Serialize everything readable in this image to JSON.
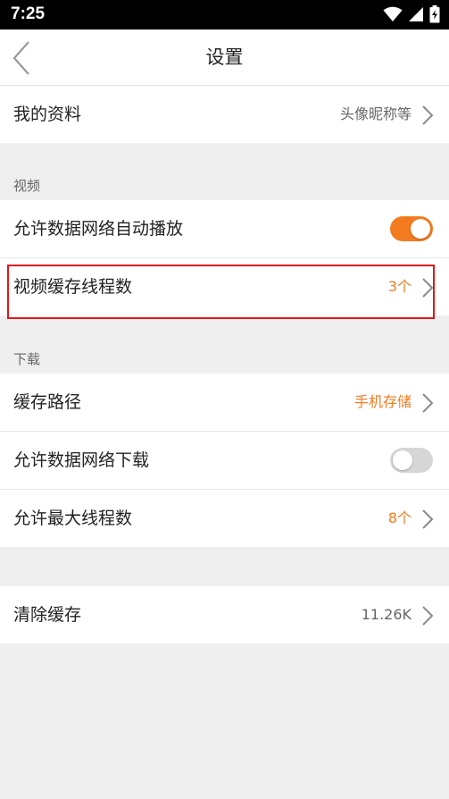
{
  "status_bar": {
    "time": "7:25",
    "icons": [
      "wifi-icon",
      "signal-icon",
      "battery-charging-icon"
    ]
  },
  "header": {
    "title": "设置",
    "back_icon": "chevron-left-icon"
  },
  "profile": {
    "label": "我的资料",
    "value": "头像昵称等"
  },
  "video_section": {
    "label": "视频",
    "autoplay": {
      "label": "允许数据网络自动播放",
      "enabled": true
    },
    "cache_threads": {
      "label": "视频缓存线程数",
      "value": "3个"
    }
  },
  "download_section": {
    "label": "下载",
    "cache_path": {
      "label": "缓存路径",
      "value": "手机存储"
    },
    "data_download": {
      "label": "允许数据网络下载",
      "enabled": false
    },
    "max_threads": {
      "label": "允许最大线程数",
      "value": "8个"
    }
  },
  "clear_cache": {
    "label": "清除缓存",
    "value": "11.26K"
  },
  "colors": {
    "accent": "#f27b1f",
    "highlight": "#e01818",
    "background": "#efefef"
  }
}
